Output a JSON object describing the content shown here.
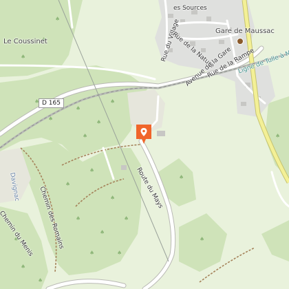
{
  "map": {
    "labels": {
      "le_coussinet": "Le Coussinet",
      "gare_de_maussac": "Gare de Maussac",
      "rue_des_sources": "es Sources",
      "rue_du_village": "Rue du Village",
      "rue_de_la_nature": "Rue de la Nature",
      "avenue_de_la_gare": "Avenue de la Gare",
      "rue_de_la_rampe": "Rue de la Rampe",
      "ligne_tulle_meymac": "Ligne de Tulle à Meymac",
      "route_du_mays": "Route du Mays",
      "chemin_des_romains": "Chemin des Romains",
      "chemin_du_menis": "Chemin du Menis",
      "davignac": "Davignac"
    },
    "road_shield": "D 165",
    "marker_icon": "location-pin-icon",
    "station_icon": "train-station-icon",
    "colors": {
      "forest": "#cfe3b9",
      "meadow": "#e9f2dc",
      "urban": "#dfe0de",
      "road": "#ffffff",
      "main_road": "#f3f096",
      "railway": "#b9bcb7",
      "marker": "#f0652b",
      "hiking_path": "#a5825a"
    }
  }
}
